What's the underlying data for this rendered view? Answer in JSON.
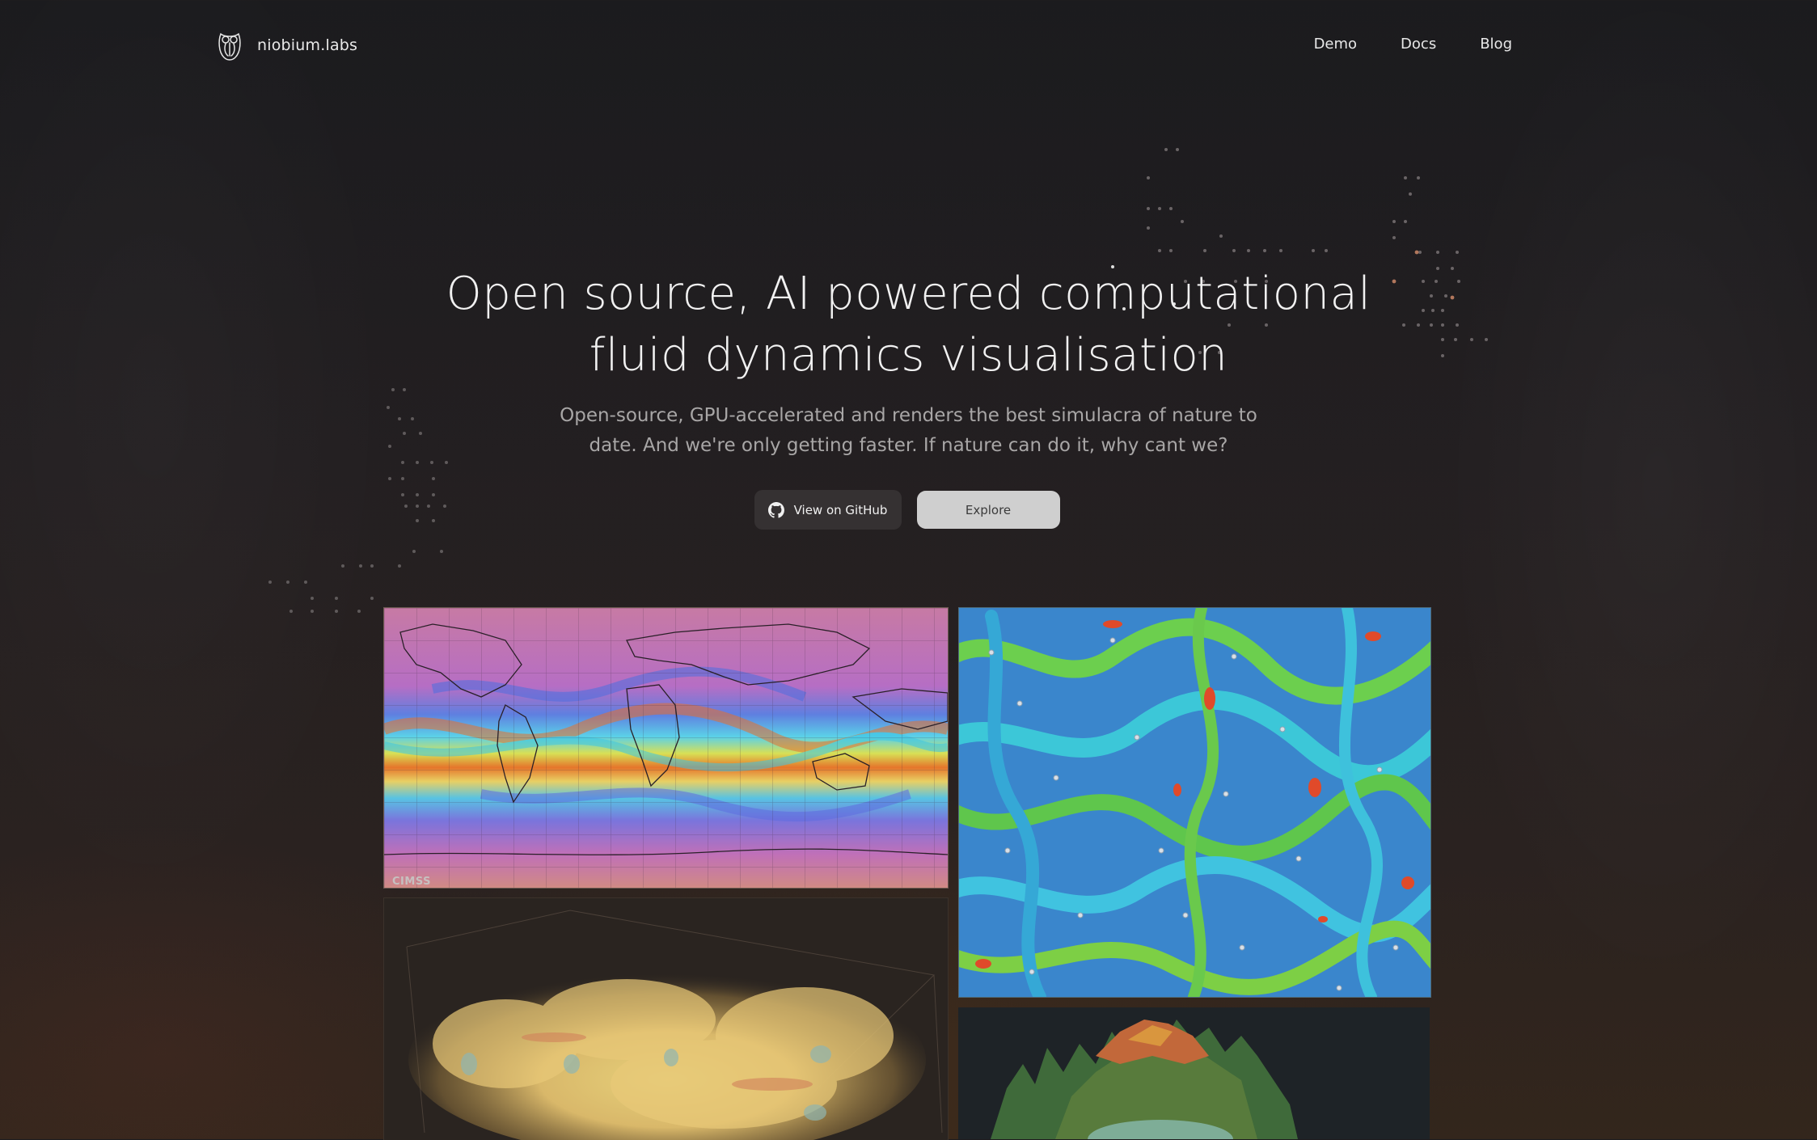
{
  "brand": {
    "name": "niobium.labs",
    "logo_icon": "owl-logo-icon"
  },
  "nav": {
    "links": [
      "Demo",
      "Docs",
      "Blog"
    ]
  },
  "hero": {
    "title_line1": "Open source, AI powered computational",
    "title_line2": "fluid dynamics visualisation",
    "subtitle_line1": "Open-source, GPU-accelerated and renders the best simulacra of nature to",
    "subtitle_line2": "date. And we're only getting faster. If nature can do it, why cant we?"
  },
  "buttons": {
    "github_label": "View on GitHub",
    "github_icon": "github-icon",
    "explore_label": "Explore"
  },
  "gallery": {
    "weather_watermark": "CIMSS"
  },
  "colors": {
    "background": "#1b1b1e",
    "explore_button": "#cfcfcf",
    "github_button": "#353132"
  }
}
